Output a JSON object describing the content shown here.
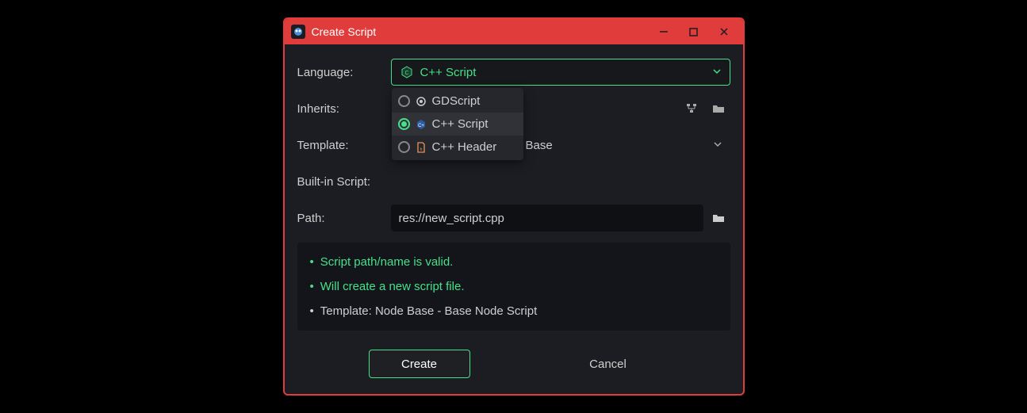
{
  "window": {
    "title": "Create Script"
  },
  "form": {
    "language": {
      "label": "Language:",
      "selected": "C++ Script",
      "options": [
        {
          "label": "GDScript",
          "selected": false
        },
        {
          "label": "C++ Script",
          "selected": true
        },
        {
          "label": "C++ Header",
          "selected": false
        }
      ]
    },
    "inherits": {
      "label": "Inherits:"
    },
    "template": {
      "label": "Template:",
      "value": "Base"
    },
    "builtin": {
      "label": "Built-in Script:"
    },
    "path": {
      "label": "Path:",
      "value": "res://new_script.cpp"
    }
  },
  "status": {
    "line1": "Script path/name is valid.",
    "line2": "Will create a new script file.",
    "line3": "Template: Node Base - Base Node Script"
  },
  "buttons": {
    "create": "Create",
    "cancel": "Cancel"
  }
}
